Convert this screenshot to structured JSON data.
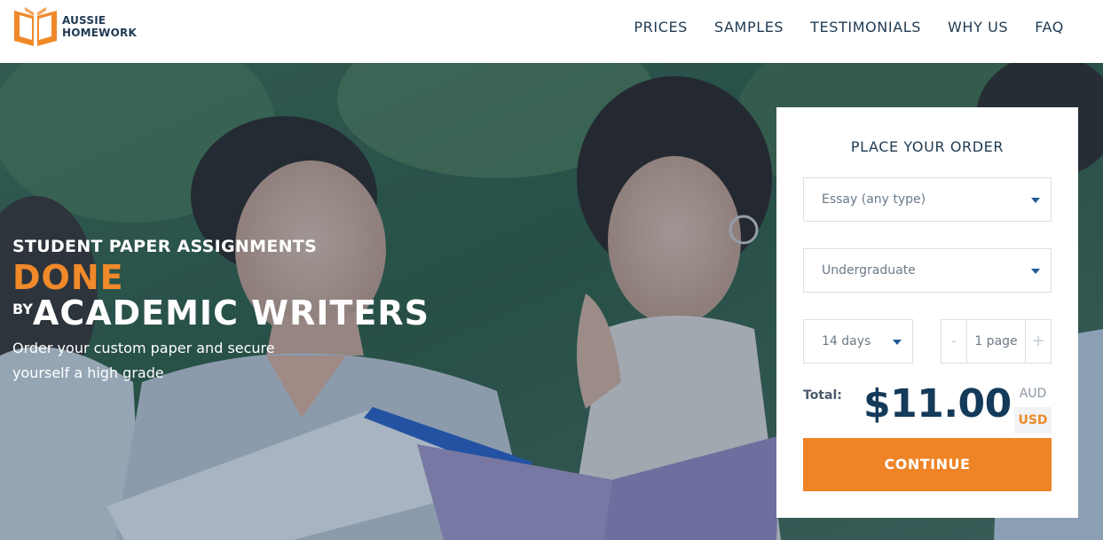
{
  "brand": {
    "line1": "AUSSIE",
    "line2": "HOMEWORK",
    "accent_color": "#f0892a",
    "icon": "open-book-logo-icon"
  },
  "nav": {
    "items": [
      "PRICES",
      "SAMPLES",
      "TESTIMONIALS",
      "WHY US",
      "FAQ"
    ]
  },
  "hero": {
    "line1": "STUDENT PAPER ASSIGNMENTS",
    "line2": "DONE",
    "line3_prefix": "BY",
    "line3_main": "ACADEMIC WRITERS",
    "subtitle": "Order your custom paper and secure yourself a high grade"
  },
  "order": {
    "title": "PLACE YOUR ORDER",
    "paper_type": "Essay (any type)",
    "academic_level": "Undergraduate",
    "deadline": "14 days",
    "pages": "1 page",
    "minus": "-",
    "plus": "+",
    "total_label": "Total:",
    "total_value": "$11.00",
    "currency_aud": "AUD",
    "currency_usd": "USD",
    "continue_label": "CONTINUE",
    "button_color": "#ef8426"
  }
}
